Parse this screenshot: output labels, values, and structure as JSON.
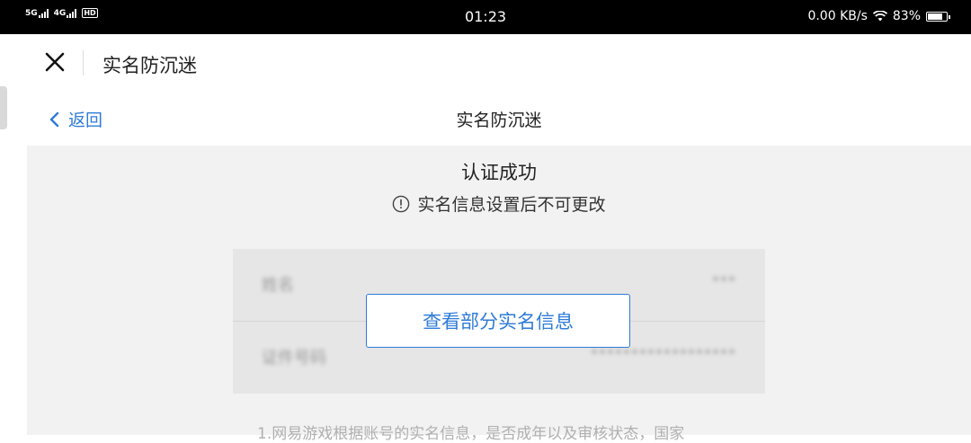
{
  "status_bar": {
    "signal_1": "5G",
    "signal_2": "4G",
    "hd_badge": "HD",
    "time": "01:23",
    "network_speed": "0.00 KB/s",
    "battery": "83%",
    "battery_level": 0.83
  },
  "outer_bar": {
    "title": "实名防沉迷"
  },
  "inner_header": {
    "back_label": "返回",
    "title": "实名防沉迷"
  },
  "content": {
    "success_title": "认证成功",
    "notice": "实名信息设置后不可更改",
    "info_rows": [
      {
        "label": "姓名",
        "value": "***"
      },
      {
        "label": "证件号码",
        "value": "******************"
      }
    ],
    "view_button_label": "查看部分实名信息",
    "footer_text": "1.网易游戏根据账号的实名信息，是否成年以及审核状态，国家"
  },
  "colors": {
    "accent": "#2f7bd8",
    "background": "#f2f2f2",
    "status_bar": "#000000"
  }
}
